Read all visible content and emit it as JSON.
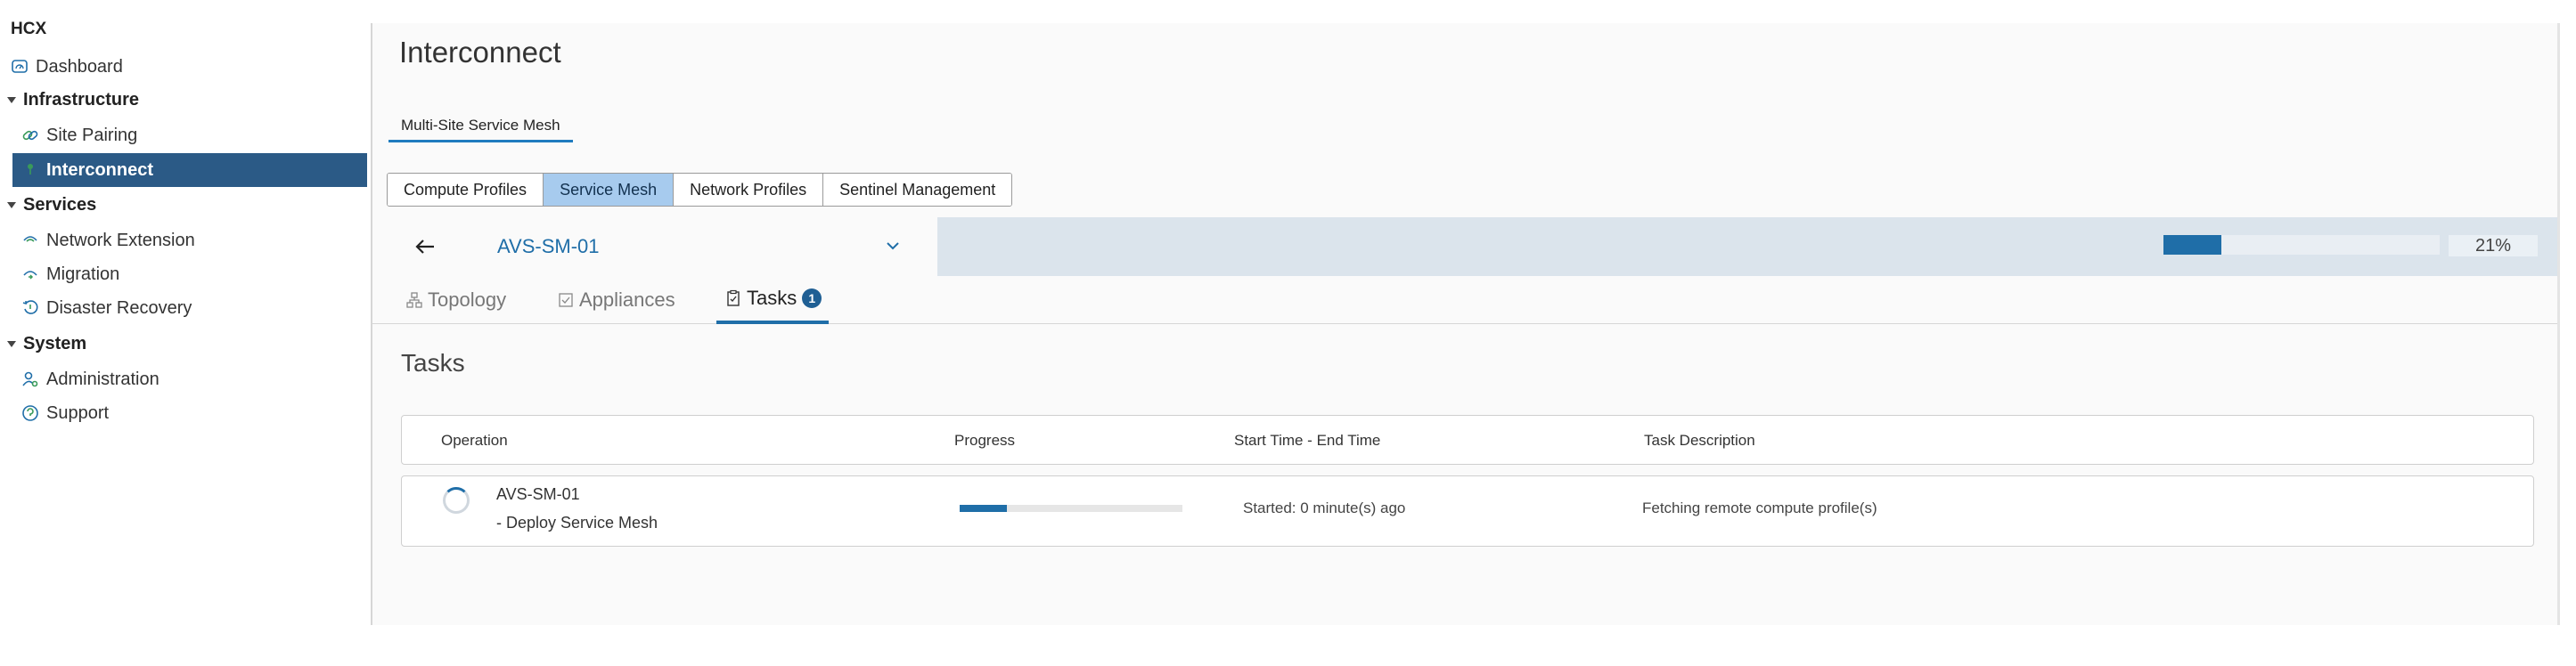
{
  "app": {
    "title": "HCX"
  },
  "sidebar": {
    "dashboard": "Dashboard",
    "groups": {
      "infrastructure": "Infrastructure",
      "services": "Services",
      "system": "System"
    },
    "items": {
      "site_pairing": "Site Pairing",
      "interconnect": "Interconnect",
      "network_extension": "Network Extension",
      "migration": "Migration",
      "disaster_recovery": "Disaster Recovery",
      "administration": "Administration",
      "support": "Support"
    }
  },
  "page": {
    "title": "Interconnect",
    "top_tab": "Multi-Site Service Mesh",
    "segments": [
      "Compute Profiles",
      "Service Mesh",
      "Network Profiles",
      "Sentinel Management"
    ],
    "active_segment": "Service Mesh"
  },
  "service_mesh": {
    "name": "AVS-SM-01",
    "progress_percent": 21,
    "progress_label": "21%"
  },
  "sub_tabs": {
    "topology": "Topology",
    "appliances": "Appliances",
    "tasks": "Tasks",
    "tasks_badge": "1",
    "active": "Tasks"
  },
  "tasks": {
    "title": "Tasks",
    "columns": {
      "operation": "Operation",
      "progress": "Progress",
      "time": "Start Time - End Time",
      "description": "Task Description"
    },
    "rows": [
      {
        "operation_name": "AVS-SM-01",
        "operation_desc": "- Deploy Service Mesh",
        "progress_fraction": 0.21,
        "time": "Started: 0 minute(s) ago",
        "description": "Fetching remote compute profile(s)"
      }
    ]
  },
  "colors": {
    "accent": "#1f6ea8",
    "active_nav": "#2b5a86",
    "active_segment": "#a7cbee",
    "mesh_bar": "#dbe4ec",
    "icon_green": "#3a9a5a"
  },
  "icons": {
    "dashboard": "dashboard-icon",
    "site_pairing": "link-icon",
    "interconnect": "pin-icon",
    "network_extension": "network-icon",
    "migration": "migration-icon",
    "disaster_recovery": "recovery-icon",
    "administration": "user-settings-icon",
    "support": "support-icon",
    "back": "back-arrow-icon",
    "dropdown": "chevron-down-icon",
    "topology": "topology-icon",
    "appliances": "appliance-icon",
    "tasks": "clipboard-icon",
    "task_status": "spinner-icon"
  }
}
